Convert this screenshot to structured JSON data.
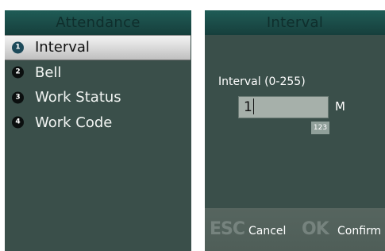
{
  "left_screen": {
    "title": "Attendance",
    "menu": [
      {
        "num": "1",
        "label": "Interval",
        "selected": true
      },
      {
        "num": "2",
        "label": "Bell",
        "selected": false
      },
      {
        "num": "3",
        "label": "Work Status",
        "selected": false
      },
      {
        "num": "4",
        "label": "Work Code",
        "selected": false
      }
    ]
  },
  "right_screen": {
    "title": "Interval",
    "field_label": "Interval (0-255)",
    "input_value": "1",
    "unit": "M",
    "input_mode": "123",
    "softkeys": {
      "cancel_icon": "ESC",
      "cancel_label": "Cancel",
      "confirm_icon": "OK",
      "confirm_label": "Confirm"
    }
  }
}
